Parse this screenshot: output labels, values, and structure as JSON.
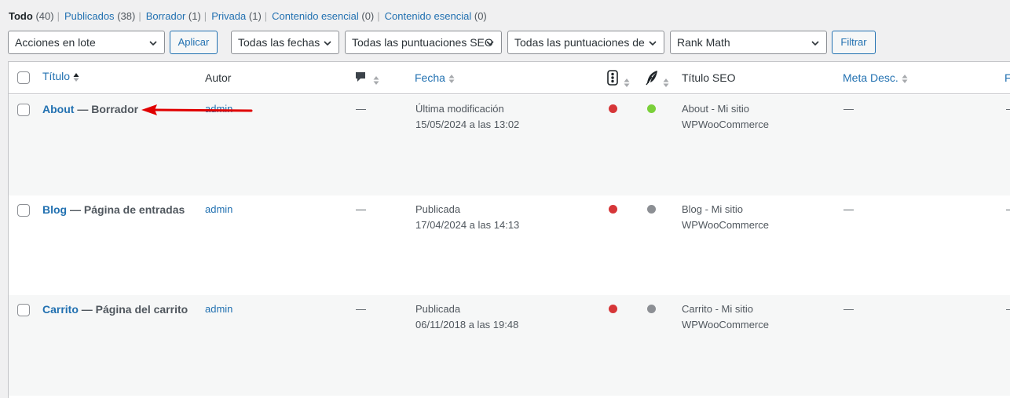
{
  "filters": [
    {
      "label": "Todo",
      "count": "(40)",
      "current": true
    },
    {
      "label": "Publicados",
      "count": "(38)",
      "current": false
    },
    {
      "label": "Borrador",
      "count": "(1)",
      "current": false
    },
    {
      "label": "Privada",
      "count": "(1)",
      "current": false
    },
    {
      "label": "Contenido esencial",
      "count": "(0)",
      "current": false
    },
    {
      "label": "Contenido esencial",
      "count": "(0)",
      "current": false
    }
  ],
  "toolbar": {
    "bulk_actions": "Acciones en lote",
    "apply": "Aplicar",
    "dates": "Todas las fechas",
    "seo_scores": "Todas las puntuaciones SEO",
    "scores_2": "Todas las puntuaciones de",
    "rank_math": "Rank Math",
    "filter": "Filtrar"
  },
  "columns": {
    "title": "Título",
    "author": "Autor",
    "date": "Fecha",
    "seo_title": "Título SEO",
    "meta_desc": "Meta Desc.",
    "cut_off": "F"
  },
  "icons": {
    "comments": "comment-bubble-icon",
    "traffic_light": "seo-score-icon",
    "feather": "readability-icon"
  },
  "colors": {
    "red": "#d63638",
    "green": "#7ad03a",
    "gray": "#8c8f94",
    "link": "#2271b1",
    "arrow": "#e00000"
  },
  "rows": [
    {
      "title": "About",
      "state": " — Borrador",
      "author": "admin",
      "comments": "—",
      "date_status": "Última modificación",
      "date": "15/05/2024 a las 13:02",
      "seo_dot": "red",
      "read_dot": "green",
      "seo_title_1": "About - Mi sitio",
      "seo_title_2": "WPWooCommerce",
      "meta": "—",
      "extra": "—"
    },
    {
      "title": "Blog",
      "state": " — Página de entradas",
      "author": "admin",
      "comments": "—",
      "date_status": "Publicada",
      "date": "17/04/2024 a las 14:13",
      "seo_dot": "red",
      "read_dot": "gray",
      "seo_title_1": "Blog - Mi sitio",
      "seo_title_2": "WPWooCommerce",
      "meta": "—",
      "extra": "—"
    },
    {
      "title": "Carrito",
      "state": " — Página del carrito",
      "author": "admin",
      "comments": "—",
      "date_status": "Publicada",
      "date": "06/11/2018 a las 19:48",
      "seo_dot": "red",
      "read_dot": "gray",
      "seo_title_1": "Carrito - Mi sitio",
      "seo_title_2": "WPWooCommerce",
      "meta": "—",
      "extra": "—"
    }
  ]
}
